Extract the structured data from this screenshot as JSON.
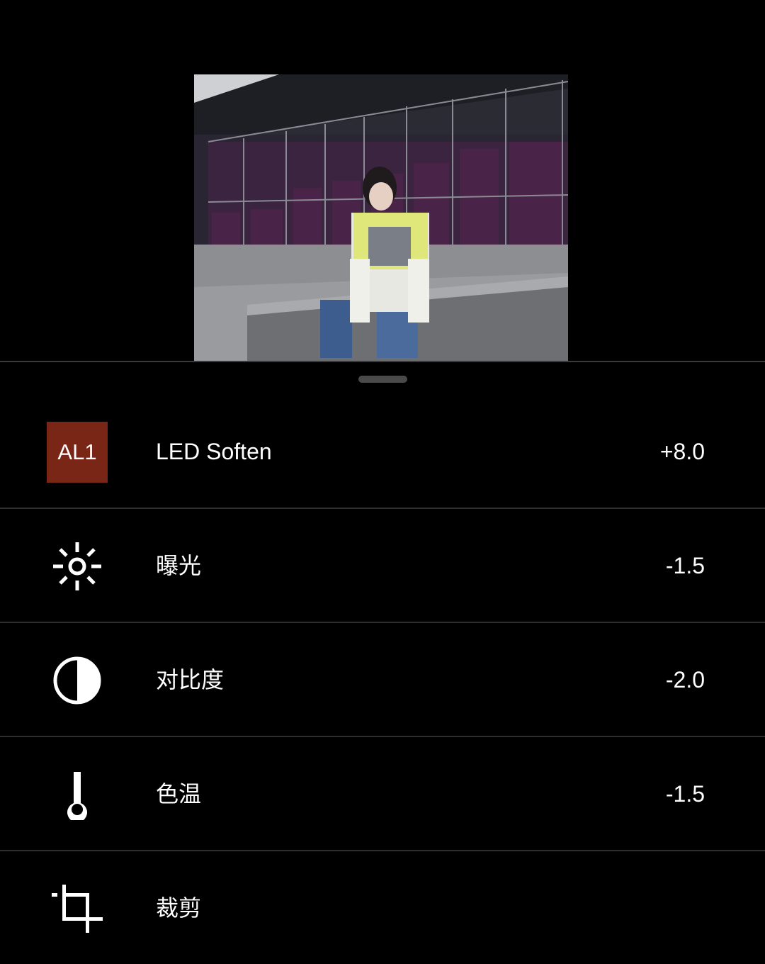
{
  "preset": {
    "badge": "AL1",
    "badge_color": "#7a2617",
    "name": "LED Soften",
    "value": "+8.0"
  },
  "tools": [
    {
      "icon": "sun-icon",
      "label": "曝光",
      "value": "-1.5"
    },
    {
      "icon": "contrast-icon",
      "label": "对比度",
      "value": "-2.0"
    },
    {
      "icon": "thermometer-icon",
      "label": "色温",
      "value": "-1.5"
    },
    {
      "icon": "crop-icon",
      "label": "裁剪",
      "value": ""
    }
  ]
}
